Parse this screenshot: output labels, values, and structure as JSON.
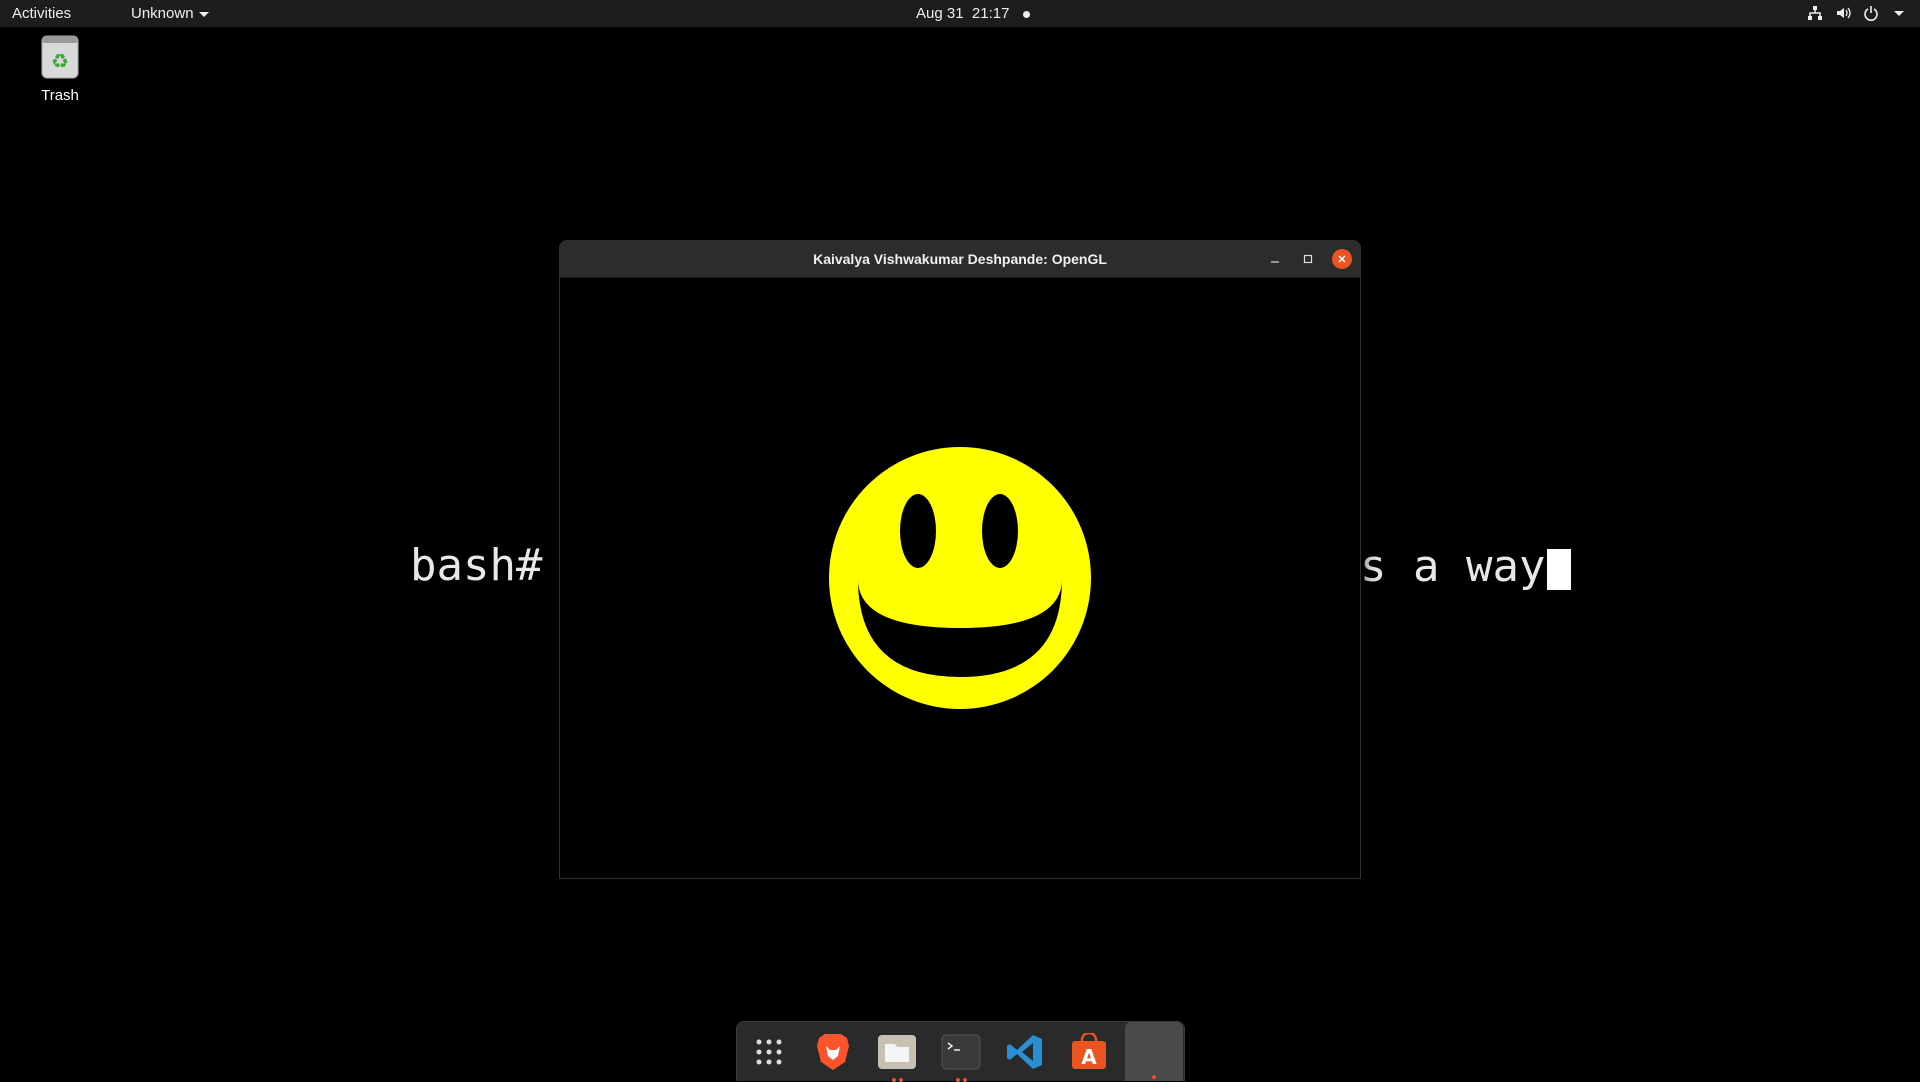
{
  "topbar": {
    "activities": "Activities",
    "app_menu": "Unknown",
    "date": "Aug 31",
    "time": "21:17"
  },
  "desktop": {
    "trash_label": "Trash"
  },
  "terminal": {
    "prompt": "bash#",
    "visible_tail": "s a way"
  },
  "window": {
    "title": "Kaivalya Vishwakumar Deshpande: OpenGL",
    "content": "yellow smiley face"
  },
  "dock": {
    "items": [
      "show-apps",
      "brave-browser",
      "files",
      "terminal",
      "vs-code",
      "software-center",
      "opengl-app"
    ]
  },
  "colors": {
    "accent": "#e95420",
    "smiley": "#ffff00",
    "topbar": "#1d1d1d"
  }
}
